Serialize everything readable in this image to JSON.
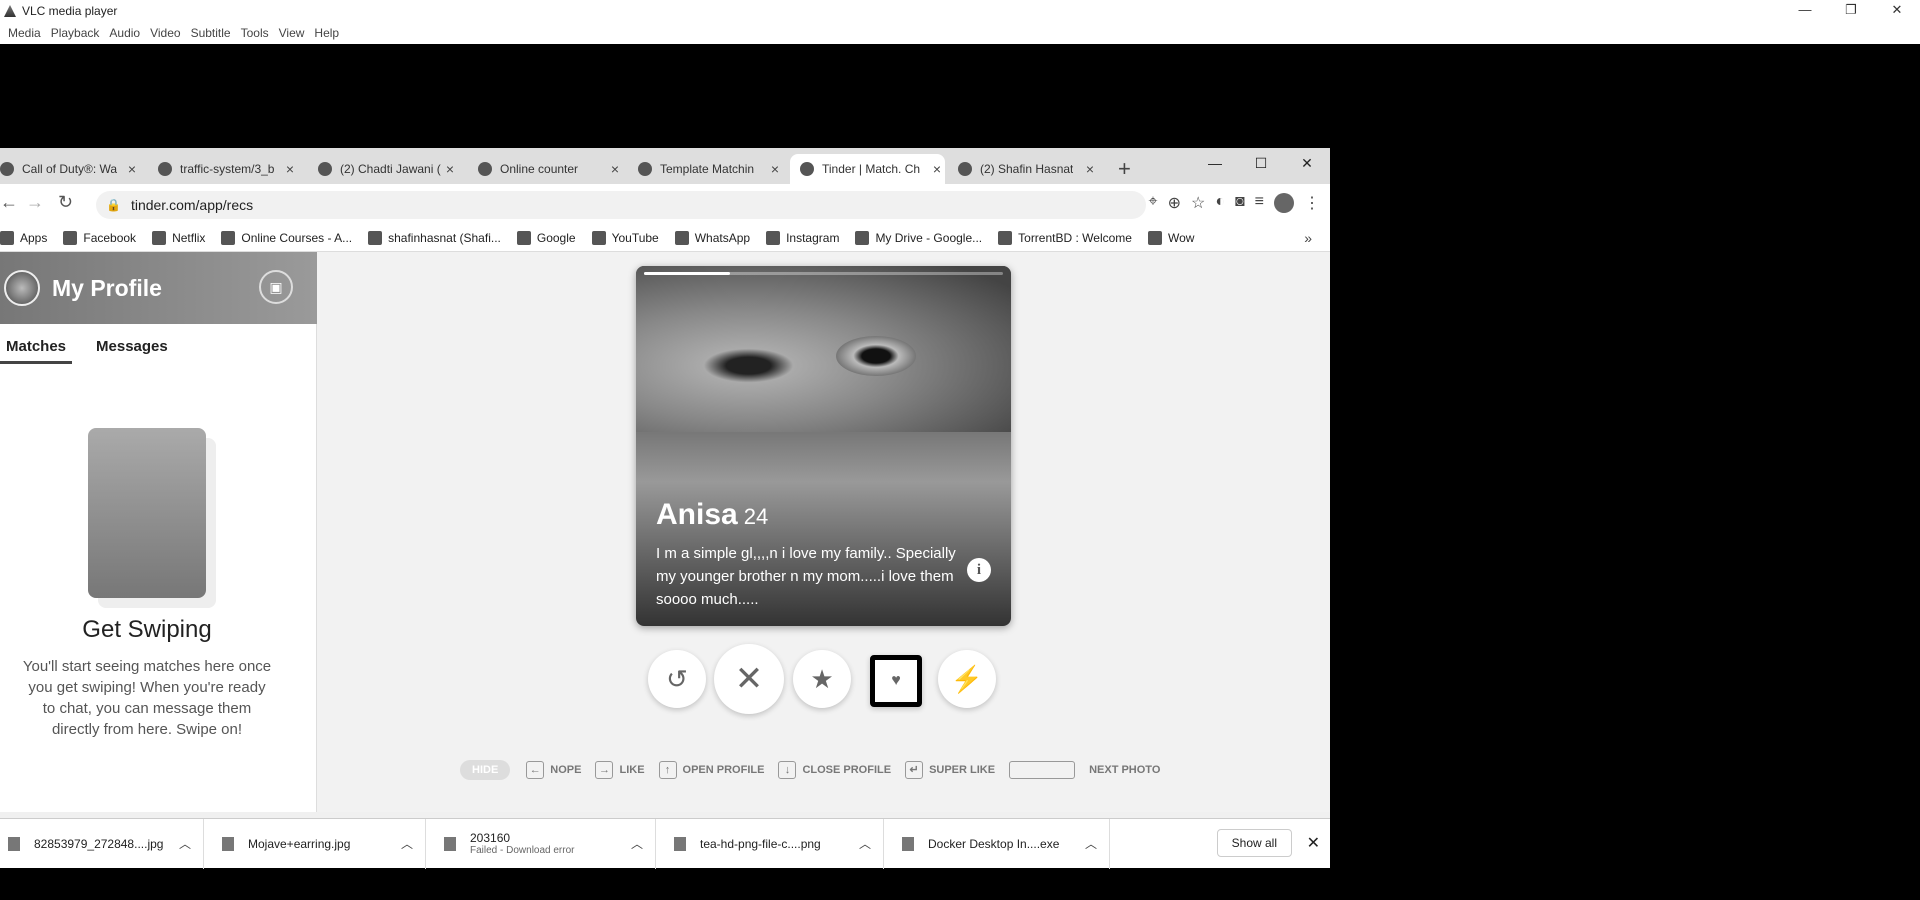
{
  "vlc": {
    "title": "VLC media player",
    "menu": [
      "Media",
      "Playback",
      "Audio",
      "Video",
      "Subtitle",
      "Tools",
      "View",
      "Help"
    ],
    "controls": [
      "—",
      "❐",
      "✕"
    ]
  },
  "browser": {
    "tabs": [
      {
        "label": "Call of Duty®: Wa",
        "icon": "warzone-icon"
      },
      {
        "label": "traffic-system/3_b",
        "icon": "github-icon"
      },
      {
        "label": "(2) Chadti Jawani (",
        "icon": "youtube-icon"
      },
      {
        "label": "Online counter",
        "icon": "globe-icon"
      },
      {
        "label": "Template Matchin",
        "icon": "page-icon"
      },
      {
        "label": "Tinder | Match. Ch",
        "icon": "tinder-flame-icon"
      },
      {
        "label": "(2) Shafin Hasnat",
        "icon": "facebook-icon"
      }
    ],
    "new_tab": "+",
    "window_controls": [
      "—",
      "☐",
      "✕"
    ],
    "url": "tinder.com/app/recs",
    "bookmarks": [
      "Apps",
      "Facebook",
      "Netflix",
      "Online Courses - A...",
      "shafinhasnat (Shafi...",
      "Google",
      "YouTube",
      "WhatsApp",
      "Instagram",
      "My Drive - Google...",
      "TorrentBD : Welcome",
      "Wow"
    ],
    "bookmarks_more": "»"
  },
  "sidebar": {
    "title": "My Profile",
    "tabs": [
      "Matches",
      "Messages"
    ],
    "empty_title": "Get Swiping",
    "empty_text": "You'll start seeing matches here once you get swiping! When you're ready to chat, you can message them directly from here. Swipe on!"
  },
  "card": {
    "name": "Anisa",
    "age": "24",
    "bio": "I m a simple gl,,,,n i love my family.. Specially my younger brother n my mom.....i love them soooo much.....",
    "info": "i",
    "photo_progress": 0.24
  },
  "actions": [
    "rewind",
    "nope",
    "super-like",
    "like",
    "boost"
  ],
  "hints": {
    "hide": "HIDE",
    "items": [
      {
        "key": "←",
        "label": "NOPE"
      },
      {
        "key": "→",
        "label": "LIKE"
      },
      {
        "key": "↑",
        "label": "OPEN PROFILE"
      },
      {
        "key": "↓",
        "label": "CLOSE PROFILE"
      },
      {
        "key": "↵",
        "label": "SUPER LIKE"
      }
    ],
    "next": "NEXT PHOTO"
  },
  "downloads": [
    {
      "name": "82853979_272848....jpg",
      "sub": ""
    },
    {
      "name": "Mojave+earring.jpg",
      "sub": ""
    },
    {
      "name": "203160",
      "sub": "Failed - Download error"
    },
    {
      "name": "tea-hd-png-file-c....png",
      "sub": ""
    },
    {
      "name": "Docker Desktop In....exe",
      "sub": ""
    }
  ],
  "show_all": "Show all",
  "close": "✕"
}
